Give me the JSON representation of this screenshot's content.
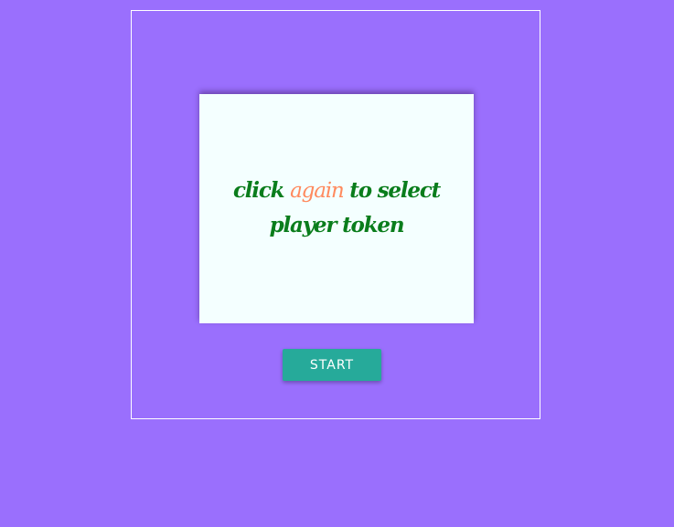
{
  "game": {
    "message_before": "click ",
    "message_highlight": "again",
    "message_after": " to select player token",
    "start_label": "START"
  },
  "colors": {
    "background": "#9a6ffd",
    "card": "#f4ffff",
    "message_text": "#0a7d1c",
    "highlight_text": "#ff8a5e",
    "start_button": "#26aa9a"
  }
}
